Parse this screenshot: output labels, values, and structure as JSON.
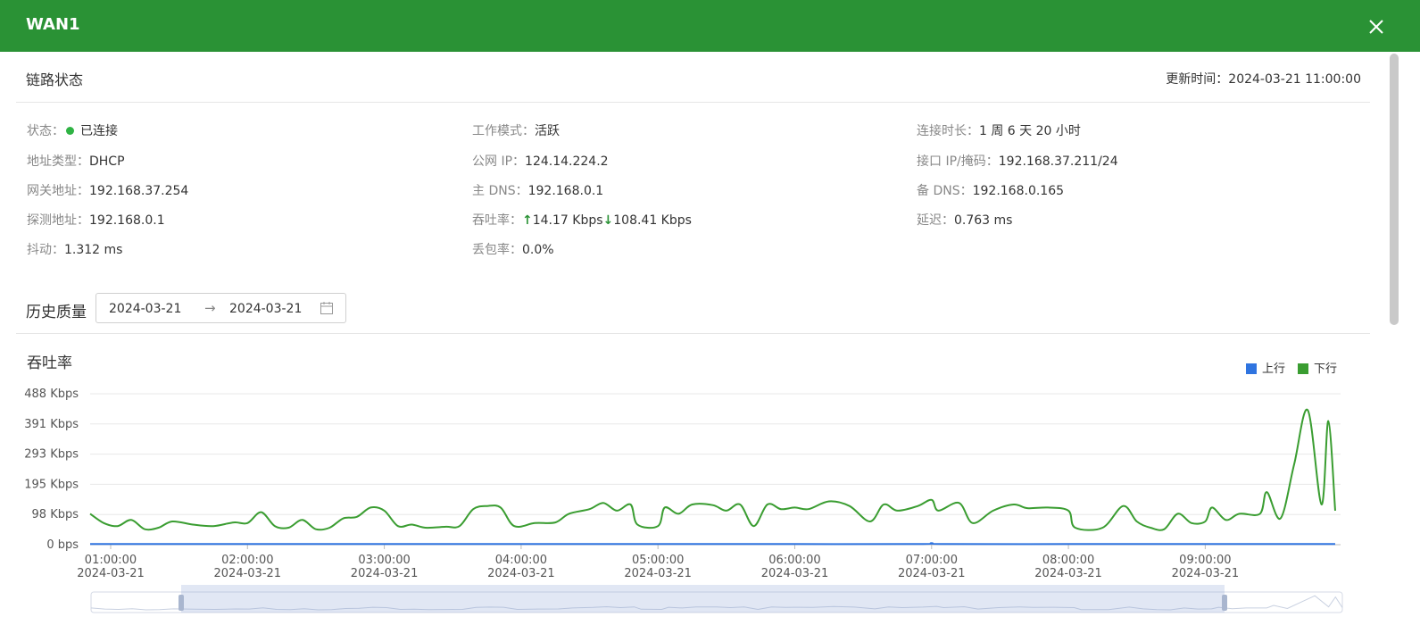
{
  "header": {
    "title": "WAN1"
  },
  "link_status": {
    "title": "链路状态",
    "update_time": "更新时间：2024-03-21 11:00:00",
    "fields": {
      "status_k": "状态：",
      "status_v": "已连接",
      "mode_k": "工作模式：",
      "mode_v": "活跃",
      "duration_k": "连接时长：",
      "duration_v": "1 周 6 天 20 小时",
      "addr_type_k": "地址类型：",
      "addr_type_v": "DHCP",
      "public_ip_k": "公网 IP：",
      "public_ip_v": "124.14.224.2",
      "iface_ip_k": "接口 IP/掩码：",
      "iface_ip_v": "192.168.37.211/24",
      "gateway_k": "网关地址：",
      "gateway_v": "192.168.37.254",
      "dns1_k": "主 DNS：",
      "dns1_v": "192.168.0.1",
      "dns2_k": "备 DNS：",
      "dns2_v": "192.168.0.165",
      "probe_k": "探测地址：",
      "probe_v": "192.168.0.1",
      "throughput_k": "吞吐率：",
      "up_arrow": "↑",
      "up_v": "14.17 Kbps",
      "down_arrow": "↓",
      "down_v": "108.41 Kbps",
      "latency_k": "延迟：",
      "latency_v": "0.763 ms",
      "jitter_k": "抖动：",
      "jitter_v": "1.312 ms",
      "loss_k": "丢包率：",
      "loss_v": "0.0%"
    }
  },
  "history": {
    "title": "历史质量",
    "date_start": "2024-03-21",
    "date_sep": "→",
    "date_end": "2024-03-21"
  },
  "colors": {
    "header": "#2a9235",
    "up": "#2f74e0",
    "down": "#3a9d31"
  },
  "chart_data": {
    "type": "line",
    "title": "吞吐率",
    "y_ticks": [
      "0 bps",
      "98 Kbps",
      "195 Kbps",
      "293 Kbps",
      "391 Kbps",
      "488 Kbps"
    ],
    "ylim": [
      0,
      488
    ],
    "x_unit": "hours",
    "xlim": [
      0.85,
      9.95
    ],
    "x_ticks": [
      {
        "x": 1,
        "time": "01:00:00",
        "date": "2024-03-21"
      },
      {
        "x": 2,
        "time": "02:00:00",
        "date": "2024-03-21"
      },
      {
        "x": 3,
        "time": "03:00:00",
        "date": "2024-03-21"
      },
      {
        "x": 4,
        "time": "04:00:00",
        "date": "2024-03-21"
      },
      {
        "x": 5,
        "time": "05:00:00",
        "date": "2024-03-21"
      },
      {
        "x": 6,
        "time": "06:00:00",
        "date": "2024-03-21"
      },
      {
        "x": 7,
        "time": "07:00:00",
        "date": "2024-03-21"
      },
      {
        "x": 8,
        "time": "08:00:00",
        "date": "2024-03-21"
      },
      {
        "x": 9,
        "time": "09:00:00",
        "date": "2024-03-21"
      }
    ],
    "legend": {
      "placement": "top-right"
    },
    "series": [
      {
        "name": "上行",
        "color": "#2f74e0",
        "points": [
          [
            0.85,
            2
          ],
          [
            2,
            2
          ],
          [
            3,
            2
          ],
          [
            4,
            2
          ],
          [
            5,
            2
          ],
          [
            6,
            2
          ],
          [
            6.9,
            2
          ],
          [
            7.0,
            5
          ],
          [
            7.1,
            2
          ],
          [
            8,
            2
          ],
          [
            9,
            2
          ],
          [
            9.95,
            2
          ]
        ]
      },
      {
        "name": "下行",
        "color": "#3a9d31",
        "points": [
          [
            0.85,
            100
          ],
          [
            0.95,
            70
          ],
          [
            1.05,
            60
          ],
          [
            1.15,
            80
          ],
          [
            1.25,
            50
          ],
          [
            1.35,
            55
          ],
          [
            1.45,
            75
          ],
          [
            1.6,
            65
          ],
          [
            1.75,
            60
          ],
          [
            1.9,
            72
          ],
          [
            2.0,
            70
          ],
          [
            2.1,
            105
          ],
          [
            2.2,
            60
          ],
          [
            2.3,
            55
          ],
          [
            2.4,
            80
          ],
          [
            2.5,
            50
          ],
          [
            2.6,
            55
          ],
          [
            2.7,
            85
          ],
          [
            2.8,
            90
          ],
          [
            2.9,
            120
          ],
          [
            3.0,
            110
          ],
          [
            3.1,
            60
          ],
          [
            3.2,
            65
          ],
          [
            3.3,
            55
          ],
          [
            3.45,
            58
          ],
          [
            3.55,
            60
          ],
          [
            3.65,
            115
          ],
          [
            3.75,
            125
          ],
          [
            3.85,
            120
          ],
          [
            3.95,
            60
          ],
          [
            4.1,
            70
          ],
          [
            4.25,
            72
          ],
          [
            4.35,
            100
          ],
          [
            4.5,
            115
          ],
          [
            4.6,
            135
          ],
          [
            4.7,
            110
          ],
          [
            4.8,
            130
          ],
          [
            4.85,
            65
          ],
          [
            5.0,
            60
          ],
          [
            5.05,
            120
          ],
          [
            5.15,
            100
          ],
          [
            5.25,
            130
          ],
          [
            5.4,
            128
          ],
          [
            5.5,
            110
          ],
          [
            5.6,
            130
          ],
          [
            5.7,
            60
          ],
          [
            5.8,
            130
          ],
          [
            5.9,
            115
          ],
          [
            6.0,
            120
          ],
          [
            6.1,
            115
          ],
          [
            6.25,
            140
          ],
          [
            6.4,
            125
          ],
          [
            6.55,
            75
          ],
          [
            6.65,
            130
          ],
          [
            6.75,
            110
          ],
          [
            6.9,
            125
          ],
          [
            7.0,
            145
          ],
          [
            7.05,
            110
          ],
          [
            7.2,
            135
          ],
          [
            7.3,
            70
          ],
          [
            7.45,
            110
          ],
          [
            7.6,
            130
          ],
          [
            7.7,
            118
          ],
          [
            7.85,
            120
          ],
          [
            8.0,
            110
          ],
          [
            8.05,
            55
          ],
          [
            8.25,
            55
          ],
          [
            8.4,
            125
          ],
          [
            8.5,
            75
          ],
          [
            8.6,
            55
          ],
          [
            8.7,
            50
          ],
          [
            8.8,
            100
          ],
          [
            8.9,
            70
          ],
          [
            9.0,
            75
          ],
          [
            9.05,
            120
          ],
          [
            9.15,
            80
          ],
          [
            9.25,
            100
          ],
          [
            9.4,
            100
          ],
          [
            9.45,
            170
          ],
          [
            9.55,
            85
          ],
          [
            9.65,
            260
          ],
          [
            9.75,
            435
          ],
          [
            9.85,
            130
          ],
          [
            9.9,
            400
          ],
          [
            9.95,
            110
          ]
        ]
      }
    ]
  }
}
